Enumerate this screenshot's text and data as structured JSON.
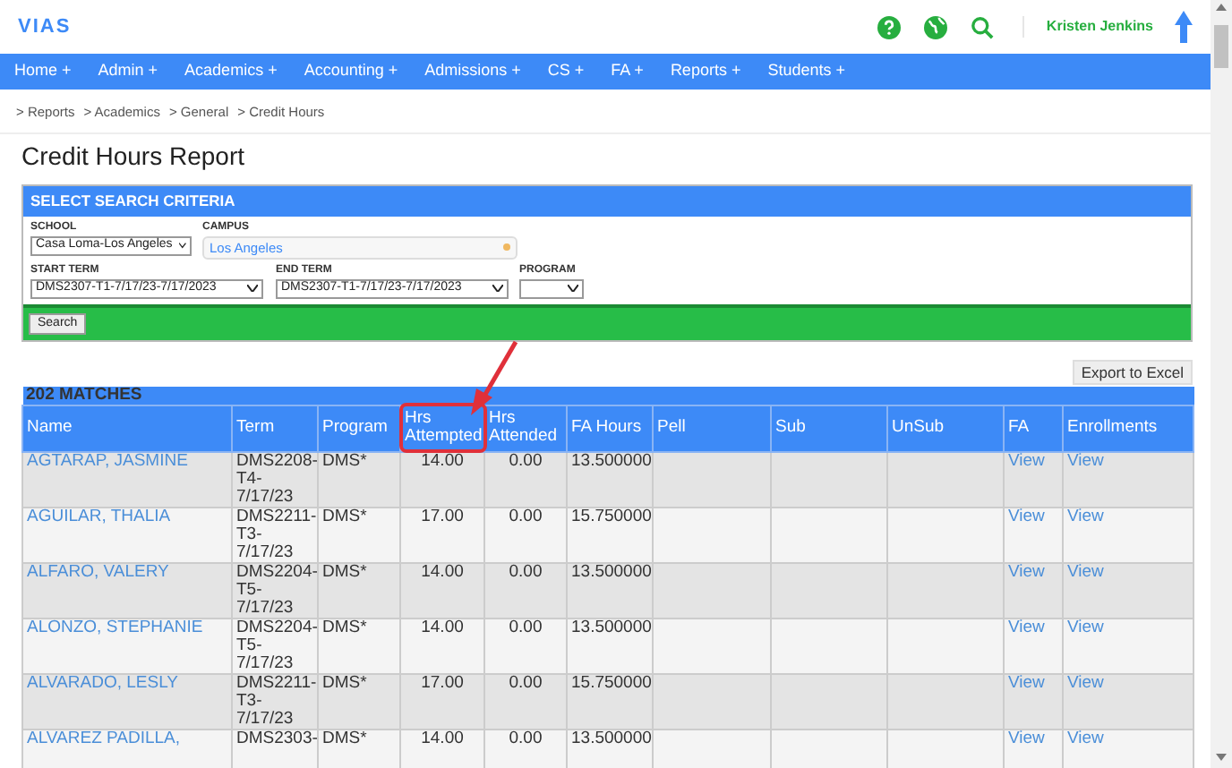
{
  "header": {
    "logo": "VIAS",
    "user": "Kristen Jenkins"
  },
  "nav": [
    "Home +",
    "Admin +",
    "Academics +",
    "Accounting +",
    "Admissions +",
    "CS +",
    "FA +",
    "Reports +",
    "Students +"
  ],
  "breadcrumb": [
    "> Reports",
    "> Academics",
    "> General",
    "> Credit Hours"
  ],
  "page_title": "Credit Hours Report",
  "criteria": {
    "title": "SELECT SEARCH CRITERIA",
    "fields": [
      {
        "kind": "select",
        "label": "SCHOOL",
        "value": "Casa Loma-Los Angeles"
      },
      {
        "kind": "picker",
        "label": "CAMPUS",
        "value": "Los Angeles"
      },
      {
        "kind": "select",
        "label": "START TERM",
        "value": "DMS2307-T1-7/17/23-7/17/2023"
      },
      {
        "kind": "select",
        "label": "END TERM",
        "value": "DMS2307-T1-7/17/23-7/17/2023"
      },
      {
        "kind": "select",
        "label": "PROGRAM"
      }
    ],
    "search_button": "Search"
  },
  "export_button": "Export to Excel",
  "results": {
    "count": "202 MATCHES",
    "columns": [
      {
        "label": "Name",
        "highlighted": false
      },
      {
        "label": "Term",
        "highlighted": false
      },
      {
        "label": "Program",
        "highlighted": false
      },
      {
        "label": "Hrs Attempted",
        "highlighted": true
      },
      {
        "label": "Hrs Attended",
        "highlighted": false
      },
      {
        "label": "FA Hours",
        "highlighted": false
      },
      {
        "label": "Pell",
        "highlighted": false
      },
      {
        "label": "Sub",
        "highlighted": false
      },
      {
        "label": "UnSub",
        "highlighted": false
      },
      {
        "label": "FA",
        "highlighted": false
      },
      {
        "label": "Enrollments",
        "highlighted": false
      }
    ],
    "rows": [
      [
        "AGTARAP, JASMINE",
        "DMS2208-T4-7/17/23",
        "DMS*",
        "14.00",
        "0.00",
        "13.500000",
        "",
        "",
        "",
        "View",
        "View"
      ],
      [
        "AGUILAR, THALIA",
        "DMS2211-T3-7/17/23",
        "DMS*",
        "17.00",
        "0.00",
        "15.750000",
        "",
        "",
        "",
        "View",
        "View"
      ],
      [
        "ALFARO, VALERY",
        "DMS2204-T5-7/17/23",
        "DMS*",
        "14.00",
        "0.00",
        "13.500000",
        "",
        "",
        "",
        "View",
        "View"
      ],
      [
        "ALONZO, STEPHANIE",
        "DMS2204-T5-7/17/23",
        "DMS*",
        "14.00",
        "0.00",
        "13.500000",
        "",
        "",
        "",
        "View",
        "View"
      ],
      [
        "ALVARADO, LESLY",
        "DMS2211-T3-7/17/23",
        "DMS*",
        "17.00",
        "0.00",
        "15.750000",
        "",
        "",
        "",
        "View",
        "View"
      ],
      [
        "ALVAREZ PADILLA,",
        "DMS2303-",
        "DMS*",
        "14.00",
        "0.00",
        "13.500000",
        "",
        "",
        "",
        "View",
        "View"
      ]
    ]
  }
}
